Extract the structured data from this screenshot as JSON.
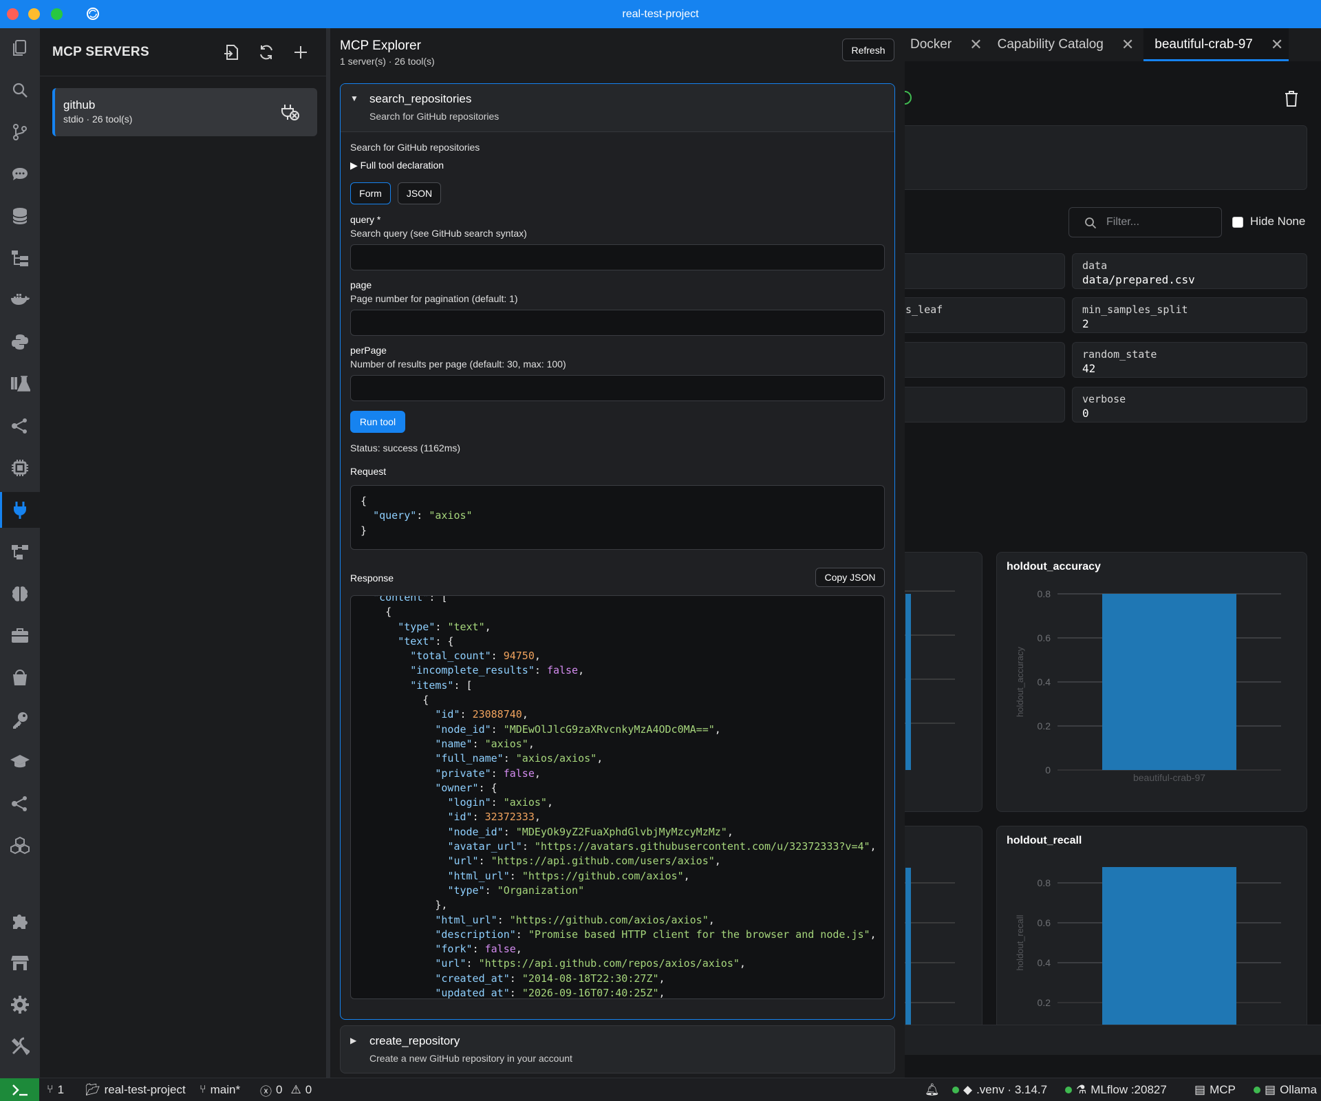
{
  "window": {
    "title": "real-test-project"
  },
  "sidebar": {
    "title": "MCP SERVERS",
    "server": {
      "name": "github",
      "subtitle": "stdio · 26 tool(s)"
    }
  },
  "explorer": {
    "title": "MCP Explorer",
    "subtitle": "1 server(s) · 26 tool(s)",
    "refresh_label": "Refresh",
    "tool": {
      "name": "search_repositories",
      "summary": "Search for GitHub repositories",
      "description": "Search for GitHub repositories",
      "declaration_label": "▶ Full tool declaration",
      "mode_form": "Form",
      "mode_json": "JSON",
      "fields": [
        {
          "name": "query *",
          "help": "Search query (see GitHub search syntax)"
        },
        {
          "name": "page",
          "help": "Page number for pagination (default: 1)"
        },
        {
          "name": "perPage",
          "help": "Number of results per page (default: 30, max: 100)"
        }
      ],
      "run_label": "Run tool",
      "status": "Status: success (1162ms)",
      "request_label": "Request",
      "response_label": "Response",
      "copy_label": "Copy JSON"
    },
    "next_tool": {
      "name": "create_repository",
      "summary": "Create a new GitHub repository in your account"
    }
  },
  "request_json": [
    [
      [
        "p",
        "{"
      ]
    ],
    [
      [
        "p",
        "  "
      ],
      [
        "k",
        "\"query\""
      ],
      [
        "p",
        ": "
      ],
      [
        "s",
        "\"axios\""
      ]
    ],
    [
      [
        "p",
        "}"
      ]
    ]
  ],
  "response_json": [
    [
      [
        "p",
        "  "
      ],
      [
        "k",
        "\"content\""
      ],
      [
        "p",
        ": ["
      ]
    ],
    [
      [
        "p",
        "    {"
      ]
    ],
    [
      [
        "p",
        "      "
      ],
      [
        "k",
        "\"type\""
      ],
      [
        "p",
        ": "
      ],
      [
        "s",
        "\"text\""
      ],
      [
        "p",
        ","
      ]
    ],
    [
      [
        "p",
        "      "
      ],
      [
        "k",
        "\"text\""
      ],
      [
        "p",
        ": {"
      ]
    ],
    [
      [
        "p",
        "        "
      ],
      [
        "k",
        "\"total_count\""
      ],
      [
        "p",
        ": "
      ],
      [
        "n",
        "94750"
      ],
      [
        "p",
        ","
      ]
    ],
    [
      [
        "p",
        "        "
      ],
      [
        "k",
        "\"incomplete_results\""
      ],
      [
        "p",
        ": "
      ],
      [
        "b",
        "false"
      ],
      [
        "p",
        ","
      ]
    ],
    [
      [
        "p",
        "        "
      ],
      [
        "k",
        "\"items\""
      ],
      [
        "p",
        ": ["
      ]
    ],
    [
      [
        "p",
        "          {"
      ]
    ],
    [
      [
        "p",
        "            "
      ],
      [
        "k",
        "\"id\""
      ],
      [
        "p",
        ": "
      ],
      [
        "n",
        "23088740"
      ],
      [
        "p",
        ","
      ]
    ],
    [
      [
        "p",
        "            "
      ],
      [
        "k",
        "\"node_id\""
      ],
      [
        "p",
        ": "
      ],
      [
        "s",
        "\"MDEwOlJlcG9zaXRvcnkyMzA4ODc0MA==\""
      ],
      [
        "p",
        ","
      ]
    ],
    [
      [
        "p",
        "            "
      ],
      [
        "k",
        "\"name\""
      ],
      [
        "p",
        ": "
      ],
      [
        "s",
        "\"axios\""
      ],
      [
        "p",
        ","
      ]
    ],
    [
      [
        "p",
        "            "
      ],
      [
        "k",
        "\"full_name\""
      ],
      [
        "p",
        ": "
      ],
      [
        "s",
        "\"axios/axios\""
      ],
      [
        "p",
        ","
      ]
    ],
    [
      [
        "p",
        "            "
      ],
      [
        "k",
        "\"private\""
      ],
      [
        "p",
        ": "
      ],
      [
        "b",
        "false"
      ],
      [
        "p",
        ","
      ]
    ],
    [
      [
        "p",
        "            "
      ],
      [
        "k",
        "\"owner\""
      ],
      [
        "p",
        ": {"
      ]
    ],
    [
      [
        "p",
        "              "
      ],
      [
        "k",
        "\"login\""
      ],
      [
        "p",
        ": "
      ],
      [
        "s",
        "\"axios\""
      ],
      [
        "p",
        ","
      ]
    ],
    [
      [
        "p",
        "              "
      ],
      [
        "k",
        "\"id\""
      ],
      [
        "p",
        ": "
      ],
      [
        "n",
        "32372333"
      ],
      [
        "p",
        ","
      ]
    ],
    [
      [
        "p",
        "              "
      ],
      [
        "k",
        "\"node_id\""
      ],
      [
        "p",
        ": "
      ],
      [
        "s",
        "\"MDEyOk9yZ2FuaXphdGlvbjMyMzcyMzMz\""
      ],
      [
        "p",
        ","
      ]
    ],
    [
      [
        "p",
        "              "
      ],
      [
        "k",
        "\"avatar_url\""
      ],
      [
        "p",
        ": "
      ],
      [
        "s",
        "\"https://avatars.githubusercontent.com/u/32372333?v=4\""
      ],
      [
        "p",
        ","
      ]
    ],
    [
      [
        "p",
        "              "
      ],
      [
        "k",
        "\"url\""
      ],
      [
        "p",
        ": "
      ],
      [
        "s",
        "\"https://api.github.com/users/axios\""
      ],
      [
        "p",
        ","
      ]
    ],
    [
      [
        "p",
        "              "
      ],
      [
        "k",
        "\"html_url\""
      ],
      [
        "p",
        ": "
      ],
      [
        "s",
        "\"https://github.com/axios\""
      ],
      [
        "p",
        ","
      ]
    ],
    [
      [
        "p",
        "              "
      ],
      [
        "k",
        "\"type\""
      ],
      [
        "p",
        ": "
      ],
      [
        "s",
        "\"Organization\""
      ]
    ],
    [
      [
        "p",
        "            },"
      ]
    ],
    [
      [
        "p",
        "            "
      ],
      [
        "k",
        "\"html_url\""
      ],
      [
        "p",
        ": "
      ],
      [
        "s",
        "\"https://github.com/axios/axios\""
      ],
      [
        "p",
        ","
      ]
    ],
    [
      [
        "p",
        "            "
      ],
      [
        "k",
        "\"description\""
      ],
      [
        "p",
        ": "
      ],
      [
        "s",
        "\"Promise based HTTP client for the browser and node.js\""
      ],
      [
        "p",
        ","
      ]
    ],
    [
      [
        "p",
        "            "
      ],
      [
        "k",
        "\"fork\""
      ],
      [
        "p",
        ": "
      ],
      [
        "b",
        "false"
      ],
      [
        "p",
        ","
      ]
    ],
    [
      [
        "p",
        "            "
      ],
      [
        "k",
        "\"url\""
      ],
      [
        "p",
        ": "
      ],
      [
        "s",
        "\"https://api.github.com/repos/axios/axios\""
      ],
      [
        "p",
        ","
      ]
    ],
    [
      [
        "p",
        "            "
      ],
      [
        "k",
        "\"created_at\""
      ],
      [
        "p",
        ": "
      ],
      [
        "s",
        "\"2014-08-18T22:30:27Z\""
      ],
      [
        "p",
        ","
      ]
    ],
    [
      [
        "p",
        "            "
      ],
      [
        "k",
        "\"updated_at\""
      ],
      [
        "p",
        ": "
      ],
      [
        "s",
        "\"2026-09-16T07:40:25Z\""
      ],
      [
        "p",
        ","
      ]
    ]
  ],
  "right": {
    "tabs": [
      {
        "label": "Docker"
      },
      {
        "label": "Capability Catalog"
      },
      {
        "label": "beautiful-crab-97"
      }
    ],
    "filter_placeholder": "Filter...",
    "hide_none_label": "Hide None",
    "params": [
      {
        "key": "",
        "value": ""
      },
      {
        "key": "data",
        "value": "data/prepared.csv"
      },
      {
        "key": "s_leaf",
        "value": ""
      },
      {
        "key": "min_samples_split",
        "value": "2"
      },
      {
        "key": "",
        "value": ""
      },
      {
        "key": "random_state",
        "value": "42"
      },
      {
        "key": "",
        "value": ""
      },
      {
        "key": "verbose",
        "value": "0"
      }
    ]
  },
  "chart_data": [
    {
      "type": "bar",
      "title": "holdout_accuracy",
      "categories": [
        "beautiful-crab-97"
      ],
      "values": [
        0.8
      ],
      "ylabel": "holdout_accuracy",
      "ylim": [
        0,
        0.8
      ],
      "yticks": [
        0,
        0.2,
        0.4,
        0.6,
        0.8
      ]
    },
    {
      "type": "bar",
      "title": "holdout_recall",
      "categories": [
        "beautiful-crab-97"
      ],
      "ylabel": "holdout_recall",
      "yticks": [
        0.2,
        0.4,
        0.6,
        0.8
      ]
    }
  ],
  "statusbar": {
    "ports": "1",
    "project": "real-test-project",
    "branch": "main*",
    "errors": "0",
    "warnings": "0",
    "venv": ".venv · 3.14.7",
    "mlflow": "MLflow :20827",
    "mcp": "MCP",
    "ollama": "Ollama"
  },
  "colors": {
    "accent": "#1683f0",
    "bar": "#1f77b4",
    "success": "#3fb950"
  }
}
